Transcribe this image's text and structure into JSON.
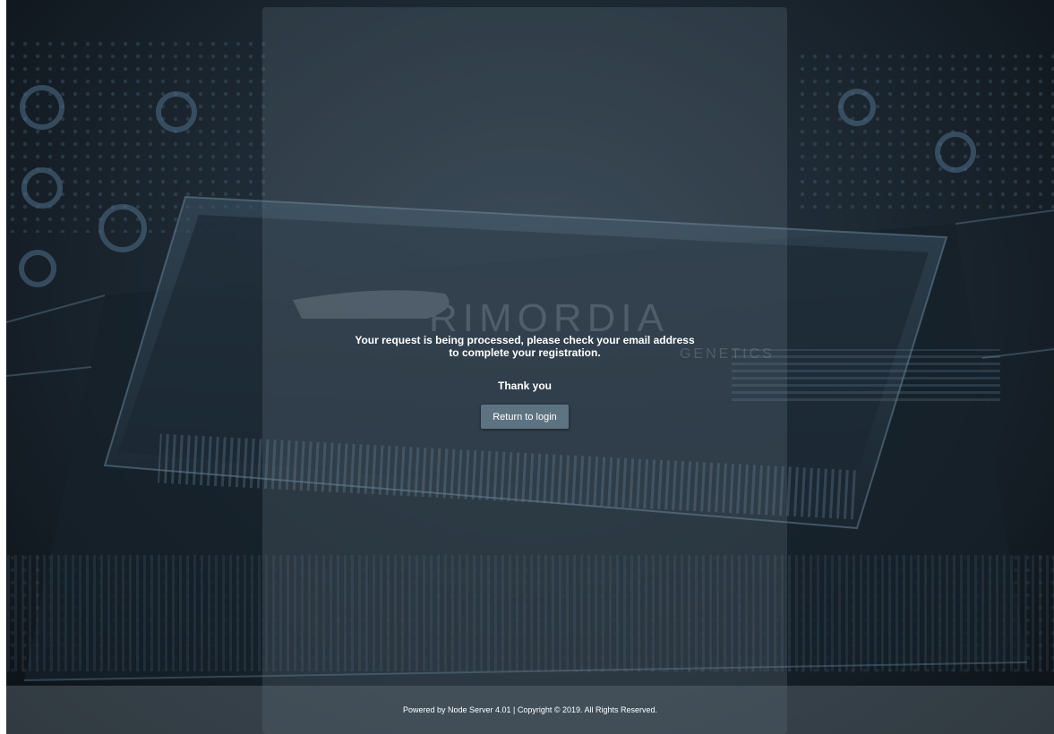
{
  "background": {
    "watermark_text": "RIMORDIA",
    "watermark_sub": "GENETICS"
  },
  "message": {
    "line1": "Your request is being processed, please check your email address",
    "line2": "to complete your registration.",
    "thanks": "Thank you"
  },
  "actions": {
    "return_label": "Return to login"
  },
  "footer": {
    "text": "Powered by Node Server 4.01 | Copyright © 2019. All Rights Reserved."
  },
  "colors": {
    "button": "#5e7382",
    "background_dark": "#121a21",
    "text": "#ffffff"
  }
}
